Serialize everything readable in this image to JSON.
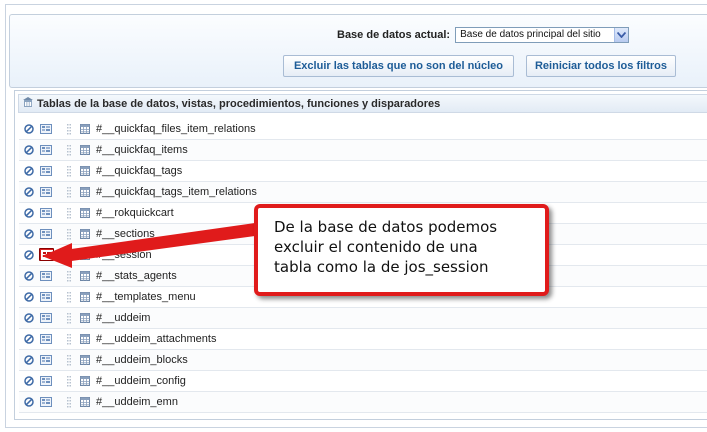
{
  "filter": {
    "db_label": "Base de datos actual:",
    "db_selected": "Base de datos principal del sitio",
    "exclude_button": "Excluir las tablas que no son del núcleo",
    "reset_button": "Reiniciar todos los filtros"
  },
  "tables": {
    "header": "Tablas de la base de datos, vistas, procedimientos, funciones y disparadores",
    "rows": [
      {
        "name": "#__quickfaq_files_item_relations"
      },
      {
        "name": "#__quickfaq_items"
      },
      {
        "name": "#__quickfaq_tags"
      },
      {
        "name": "#__quickfaq_tags_item_relations"
      },
      {
        "name": "#__rokquickcart"
      },
      {
        "name": "#__sections"
      },
      {
        "name": "#__session"
      },
      {
        "name": "#__stats_agents"
      },
      {
        "name": "#__templates_menu"
      },
      {
        "name": "#__uddeim"
      },
      {
        "name": "#__uddeim_attachments"
      },
      {
        "name": "#__uddeim_blocks"
      },
      {
        "name": "#__uddeim_config"
      },
      {
        "name": "#__uddeim_emn"
      }
    ]
  },
  "callout": {
    "line1": "De la base de datos podemos",
    "line2": "excluir el contenido de una",
    "line3": "tabla como la de jos_session"
  },
  "colors": {
    "accent_red": "#e01b1b",
    "button_text": "#1d5c97",
    "panel_border": "#c3cfdd"
  },
  "icons": {
    "row_block": "no-entry-icon",
    "row_exclude": "exclude-table-icon",
    "row_drag": "drag-handle-icon",
    "row_table": "table-icon",
    "header": "database-icon"
  }
}
